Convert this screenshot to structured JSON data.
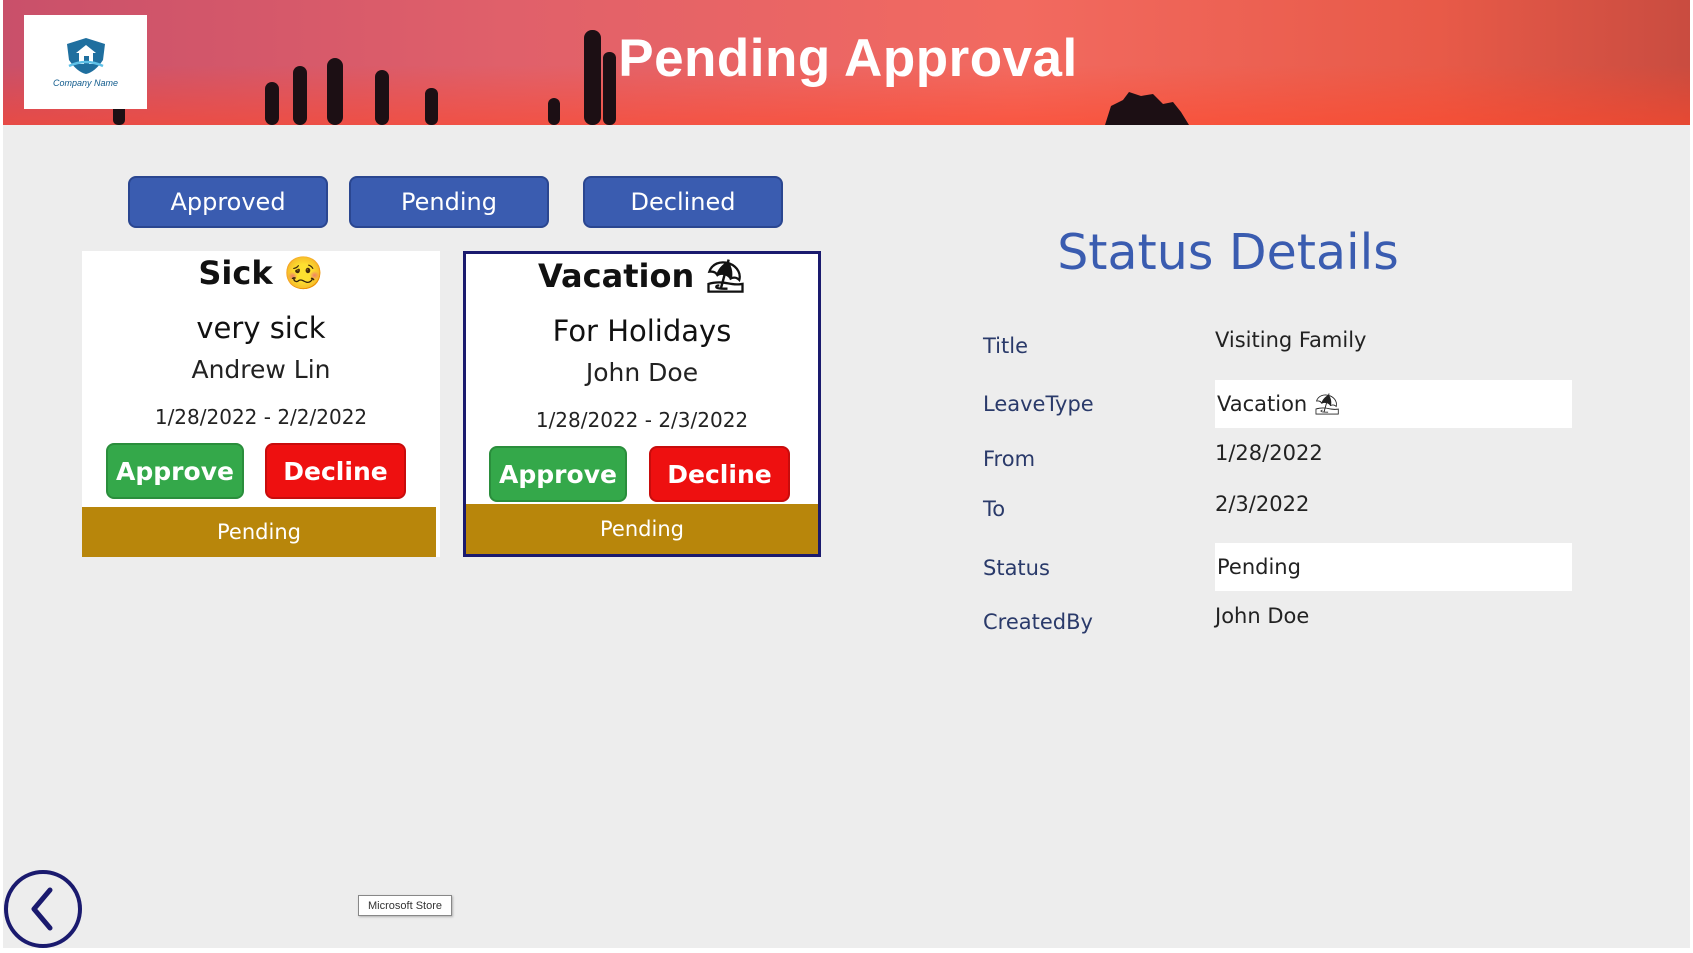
{
  "header": {
    "title": "Pending Approval",
    "logo_text": "Company Name"
  },
  "filters": {
    "approved": "Approved",
    "pending": "Pending",
    "declined": "Declined"
  },
  "cards": [
    {
      "leave_type": "Sick 🥴",
      "title": "very sick",
      "name": "Andrew Lin",
      "dates": "1/28/2022 - 2/2/2022",
      "approve_label": "Approve",
      "decline_label": "Decline",
      "status": "Pending"
    },
    {
      "leave_type": "Vacation ⛱",
      "title": "For Holidays",
      "name": "John Doe",
      "dates": "1/28/2022 - 2/3/2022",
      "approve_label": "Approve",
      "decline_label": "Decline",
      "status": "Pending"
    }
  ],
  "details": {
    "heading": "Status Details",
    "rows": [
      {
        "label": "Title",
        "value": "Visiting Family"
      },
      {
        "label": "LeaveType",
        "value": "Vacation ⛱"
      },
      {
        "label": "From",
        "value": "1/28/2022"
      },
      {
        "label": "To",
        "value": "2/3/2022"
      },
      {
        "label": "Status",
        "value": "Pending"
      },
      {
        "label": "CreatedBy",
        "value": "John Doe"
      }
    ]
  },
  "store_tag": "Microsoft Store",
  "colors": {
    "primary_blue": "#3a5cb0",
    "approve_green": "#34a84a",
    "decline_red": "#ee1010",
    "pending_gold": "#b8860b",
    "navy": "#1a1a6e"
  },
  "icons": {
    "logo": "house-shield-icon",
    "back": "chevron-left-icon"
  }
}
